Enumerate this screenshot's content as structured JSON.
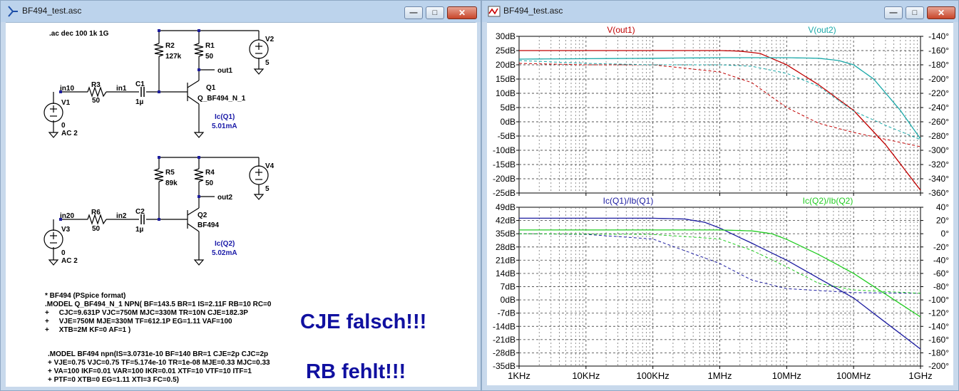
{
  "left_window": {
    "title": "BF494_test.asc",
    "directive": ".ac dec 100 1k 1G",
    "circuit1": {
      "r2_name": "R2",
      "r2_value": "127k",
      "r1_name": "R1",
      "r1_value": "50",
      "v2_name": "V2",
      "v2_value": "5",
      "out_label": "out1",
      "q_name": "Q1",
      "q_model": "Q_BF494_N_1",
      "in_label": "in10",
      "r3_name": "R3",
      "r3_value": "50",
      "node_label": "in1",
      "c_name": "C1",
      "c_value": "1µ",
      "v_name": "V1",
      "v_dc": "0",
      "v_ac": "AC 2",
      "ic_label": "Ic(Q1)",
      "ic_value": "5.01mA"
    },
    "circuit2": {
      "r5_name": "R5",
      "r5_value": "89k",
      "r4_name": "R4",
      "r4_value": "50",
      "v4_name": "V4",
      "v4_value": "5",
      "out_label": "out2",
      "q_name": "Q2",
      "q_model": "BF494",
      "in_label": "in20",
      "r6_name": "R6",
      "r6_value": "50",
      "node_label": "in2",
      "c_name": "C2",
      "c_value": "1µ",
      "v_name": "V3",
      "v_dc": "0",
      "v_ac": "AC 2",
      "ic_label": "Ic(Q2)",
      "ic_value": "5.02mA"
    },
    "model1_lines": [
      "* BF494 (PSpice format)",
      ".MODEL Q_BF494_N_1 NPN( BF=143.5 BR=1 IS=2.11F RB=10 RC=0",
      "+     CJC=9.631P VJC=750M MJC=330M TR=10N CJE=182.3P",
      "+     VJE=750M MJE=330M TF=612.1P EG=1.11 VAF=100",
      "+     XTB=2M KF=0 AF=1 )"
    ],
    "model2_lines": [
      ".MODEL BF494 npn(IS=3.0731e-10 BF=140 BR=1 CJE=2p CJC=2p",
      "+ VJE=0.75 VJC=0.75 TF=5.174e-10 TR=1e-08 MJE=0.33 MJC=0.33",
      "+ VA=100 IKF=0.01 VAR=100 IKR=0.01 XTF=10 VTF=10 ITF=1",
      "+ PTF=0 XTB=0 EG=1.11 XTI=3 FC=0.5)"
    ],
    "note1": "CJE falsch!!!",
    "note2": "RB fehlt!!!"
  },
  "right_window": {
    "title": "BF494_test.asc"
  },
  "colors": {
    "v_out1": "#c00000",
    "v_out2": "#1aa8a8",
    "ic_q1": "#1c1ca0",
    "ic_q2": "#22cc22",
    "annotation": "#1010a0",
    "title_bar": "#bcd3ec"
  },
  "chart_data": [
    {
      "type": "line",
      "x_scale": "log",
      "xlim_hz": [
        1000,
        1000000000
      ],
      "x_tick_labels": [
        "1KHz",
        "10KHz",
        "100KHz",
        "1MHz",
        "10MHz",
        "100MHz",
        "1GHz"
      ],
      "y_left_tick_labels": [
        "30dB",
        "25dB",
        "20dB",
        "15dB",
        "10dB",
        "5dB",
        "0dB",
        "-5dB",
        "-10dB",
        "-15dB",
        "-20dB",
        "-25dB"
      ],
      "y_right_tick_labels": [
        "-140°",
        "-160°",
        "-180°",
        "-200°",
        "-220°",
        "-240°",
        "-260°",
        "-280°",
        "-300°",
        "-320°",
        "-340°",
        "-360°"
      ],
      "ylim_db": [
        -25,
        30
      ],
      "ylim_deg": [
        -360,
        -140
      ],
      "grid": true,
      "series": [
        {
          "name": "V(out1)",
          "color_key": "v_out1",
          "magnitude_db": {
            "x": [
              1000,
              100000,
              1000000,
              2000000,
              4000000,
              10000000,
              30000000,
              100000000,
              300000000,
              1000000000
            ],
            "y": [
              25,
              25,
              25,
              24.8,
              24,
              20,
              13,
              4,
              -8,
              -24
            ]
          },
          "phase_deg": {
            "x": [
              1000,
              10000,
              100000,
              1000000,
              3000000,
              10000000,
              30000000,
              100000000,
              1000000000
            ],
            "y": [
              -178,
              -180,
              -180,
              -190,
              -205,
              -240,
              -262,
              -275,
              -295
            ]
          }
        },
        {
          "name": "V(out2)",
          "color_key": "v_out2",
          "magnitude_db": {
            "x": [
              1000,
              100000,
              1000000,
              10000000,
              30000000,
              60000000,
              100000000,
              200000000,
              500000000,
              1000000000
            ],
            "y": [
              22,
              22.3,
              22.5,
              22.5,
              22.3,
              21.5,
              20,
              15,
              4,
              -6
            ]
          },
          "phase_deg": {
            "x": [
              1000,
              10000,
              100000,
              1000000,
              3000000,
              10000000,
              30000000,
              100000000,
              300000000,
              1000000000
            ],
            "y": [
              -174,
              -178,
              -180,
              -180,
              -182,
              -192,
              -210,
              -245,
              -265,
              -285
            ]
          }
        }
      ]
    },
    {
      "type": "line",
      "x_scale": "log",
      "xlim_hz": [
        1000,
        1000000000
      ],
      "x_tick_labels": [
        "1KHz",
        "10KHz",
        "100KHz",
        "1MHz",
        "10MHz",
        "100MHz",
        "1GHz"
      ],
      "y_left_tick_labels": [
        "49dB",
        "42dB",
        "35dB",
        "28dB",
        "21dB",
        "14dB",
        "7dB",
        "0dB",
        "-7dB",
        "-14dB",
        "-21dB",
        "-28dB",
        "-35dB"
      ],
      "y_right_tick_labels": [
        "40°",
        "20°",
        "0°",
        "-20°",
        "-40°",
        "-60°",
        "-80°",
        "-100°",
        "-120°",
        "-140°",
        "-160°",
        "-180°",
        "-200°"
      ],
      "ylim_db": [
        -35,
        49
      ],
      "ylim_deg": [
        -200,
        40
      ],
      "grid": true,
      "series": [
        {
          "name": "Ic(Q1)/Ib(Q1)",
          "color_key": "ic_q1",
          "magnitude_db": {
            "x": [
              1000,
              100000,
              300000,
              600000,
              1000000,
              3000000,
              10000000,
              100000000,
              1000000000
            ],
            "y": [
              43.2,
              43.2,
              42.8,
              41,
              38,
              30,
              21,
              1,
              -26
            ]
          },
          "phase_deg": {
            "x": [
              1000,
              10000,
              100000,
              1000000,
              3000000,
              10000000,
              100000000,
              1000000000
            ],
            "y": [
              0,
              -1,
              -8,
              -45,
              -70,
              -83,
              -89,
              -90
            ]
          }
        },
        {
          "name": "Ic(Q2)/Ib(Q2)",
          "color_key": "ic_q2",
          "magnitude_db": {
            "x": [
              1000,
              1000000,
              3000000,
              6000000,
              10000000,
              30000000,
              100000000,
              1000000000
            ],
            "y": [
              37,
              37,
              36.5,
              35,
              32,
              24,
              14,
              -9
            ]
          },
          "phase_deg": {
            "x": [
              1000,
              100000,
              1000000,
              3000000,
              10000000,
              30000000,
              100000000,
              1000000000
            ],
            "y": [
              0,
              -1,
              -8,
              -25,
              -50,
              -75,
              -85,
              -90
            ]
          }
        }
      ]
    }
  ]
}
